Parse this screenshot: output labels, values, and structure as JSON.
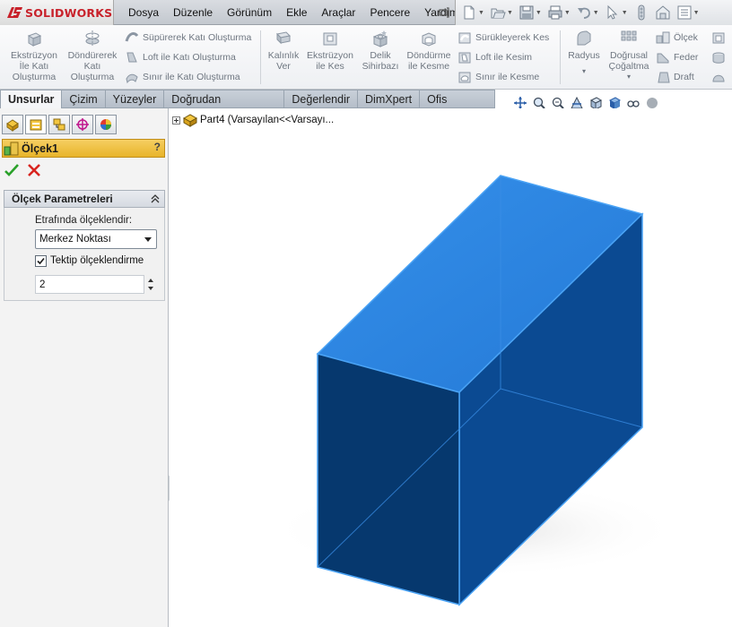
{
  "app": {
    "logo_text": "SOLIDWORKS"
  },
  "menu": [
    "Dosya",
    "Düzenle",
    "Görünüm",
    "Ekle",
    "Araçlar",
    "Pencere",
    "Yardım"
  ],
  "ribbon": {
    "extrude_boss": {
      "line1": "Ekstrüzyon",
      "line2": "İle Katı",
      "line3": "Oluşturma"
    },
    "revolve_boss": {
      "line1": "Döndürerek",
      "line2": "Katı",
      "line3": "Oluşturma"
    },
    "sweep_boss": "Süpürerek Katı Oluşturma",
    "loft_boss": "Loft ile Katı Oluşturma",
    "boundary_boss": "Sınır ile Katı Oluşturma",
    "thicken": {
      "line1": "Kalınlık",
      "line2": "Ver"
    },
    "extrude_cut": {
      "line1": "Ekstrüzyon",
      "line2": "ile Kes"
    },
    "hole_wizard": {
      "line1": "Delik",
      "line2": "Sihirbazı"
    },
    "revolve_cut": {
      "line1": "Döndürme",
      "line2": "ile Kesme"
    },
    "sweep_cut": "Sürükleyerek Kes",
    "loft_cut": "Loft ile Kesim",
    "boundary_cut": "Sınır ile Kesme",
    "fillet": "Radyus",
    "linear_pattern": {
      "line1": "Doğrusal",
      "line2": "Çoğaltma"
    },
    "scale": "Ölçek",
    "rib": "Feder",
    "draft": "Draft"
  },
  "tabs": [
    "Unsurlar",
    "Çizim",
    "Yüzeyler",
    "Doğrudan Düzenleme",
    "Değerlendir",
    "DimXpert",
    "Ofis Ürünleri"
  ],
  "property_manager": {
    "title": "Ölçek1",
    "help": "?",
    "group_title": "Ölçek Parametreleri",
    "scale_about_label": "Etrafında ölçeklendir:",
    "scale_about_value": "Merkez Noktası",
    "uniform_label": "Tektip ölçeklendirme",
    "uniform_checked": true,
    "factor_value": "2"
  },
  "tree": {
    "label": "Part4  (Varsayılan<<Varsayı..."
  },
  "colors": {
    "model_top": "#2f86e0",
    "model_front": "#06386e",
    "model_side": "#0c4a92",
    "model_edge": "#4aa3f5"
  }
}
